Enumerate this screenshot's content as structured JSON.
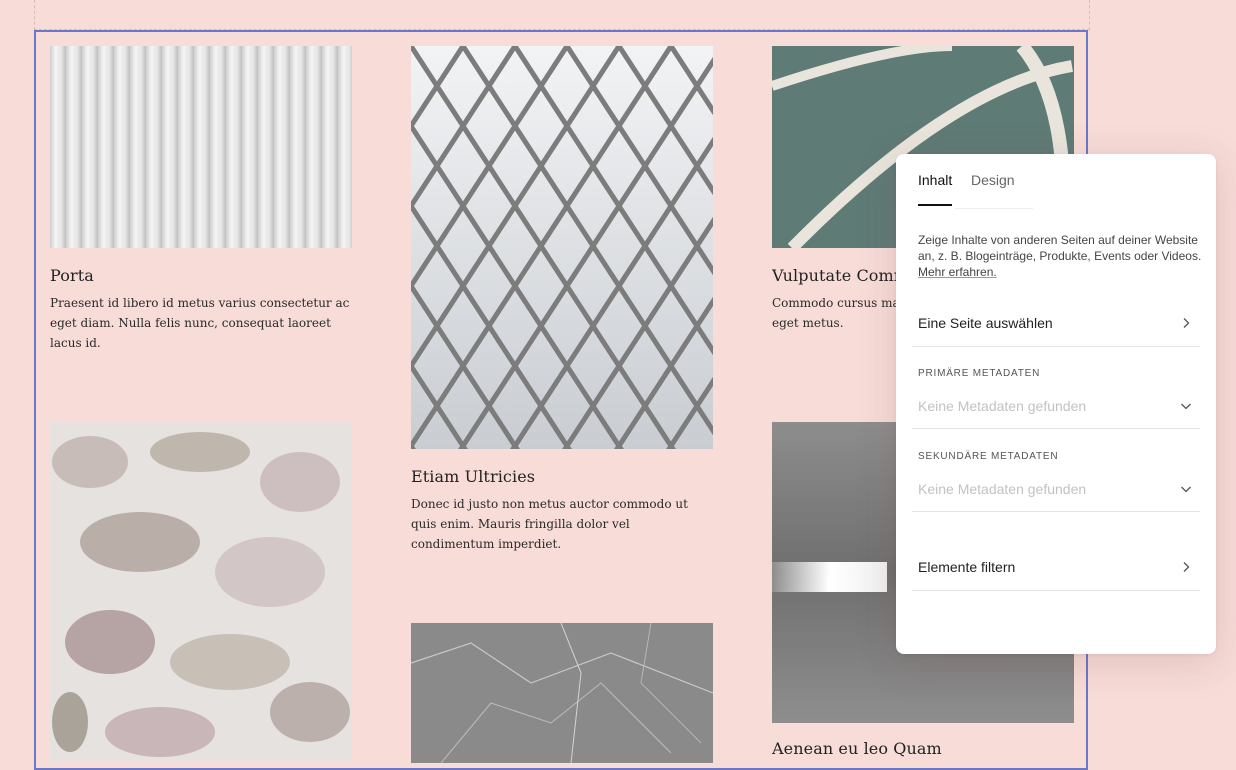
{
  "cards": [
    {
      "title": "Porta",
      "body": "Praesent id libero id metus varius consectetur ac eget diam. Nulla felis nunc, consequat laoreet lacus id."
    },
    {
      "title": "Etiam Ultricies",
      "body": "Donec id justo non metus auctor commodo ut quis enim. Mauris fringilla dolor vel condimentum imperdiet."
    },
    {
      "title": "Vulputate Commo",
      "body": "Commodo cursus mag consectetur et. Donec eget metus."
    },
    {
      "title": "Aenean eu leo Quam",
      "body": ""
    }
  ],
  "panel": {
    "tabs": [
      "Inhalt",
      "Design"
    ],
    "active_tab": "Inhalt",
    "description": "Zeige Inhalte von anderen Seiten auf deiner Website an, z. B. Blogeinträge, Produkte, Events oder Videos.",
    "learn_more": "Mehr erfahren.",
    "select_page": "Eine Seite auswählen",
    "primary_label": "PRIMÄRE METADATEN",
    "primary_placeholder": "Keine Metadaten gefunden",
    "secondary_label": "SEKUNDÄRE METADATEN",
    "secondary_placeholder": "Keine Metadaten gefunden",
    "filter_items": "Elemente filtern"
  },
  "colors": {
    "background": "#f7dcd8",
    "frame": "#6c76c9",
    "panel": "#ffffff"
  }
}
